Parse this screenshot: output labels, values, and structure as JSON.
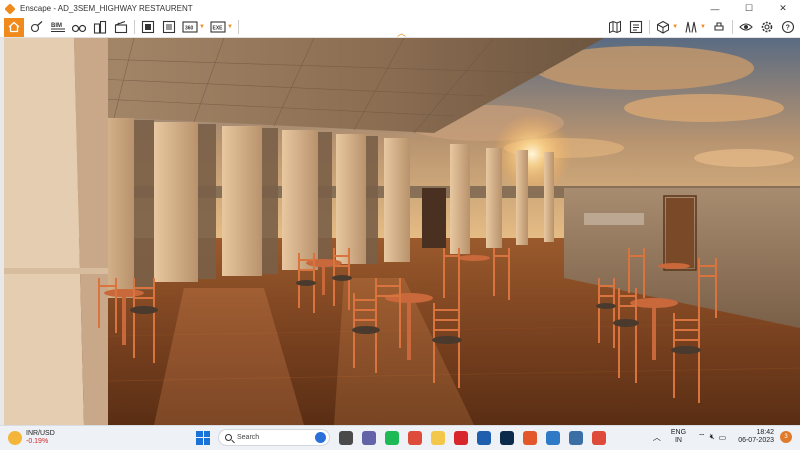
{
  "window": {
    "title": "Enscape - AD_3SEM_HIGHWAY RESTAURENT",
    "controls": [
      "—",
      "☐",
      "✕"
    ]
  },
  "toolbar": {
    "left_icons": [
      "home-icon",
      "walk-mode-icon",
      "bim-icon",
      "binoculars-icon",
      "buildings-icon",
      "clapper-icon",
      "screenshot-icon",
      "batch-render-icon",
      "panorama-icon",
      "export-icon"
    ],
    "right_icons": [
      "map-icon",
      "views-icon",
      "asset-library-icon",
      "material-editor-icon",
      "upload-icon",
      "visual-settings-icon",
      "settings-icon",
      "help-icon"
    ],
    "bim_label": "BIM",
    "view360_label": "360",
    "exe_label": "EXE"
  },
  "colors": {
    "accent": "#f08a1c"
  },
  "taskbar": {
    "weather_title": "INR/USD",
    "weather_sub": "-0.19%",
    "search_label": "Search",
    "lang_top": "ENG",
    "lang_bottom": "IN",
    "time": "18:42",
    "date": "06-07-2023",
    "notif_count": "3",
    "apps": [
      {
        "name": "task-view-icon",
        "color": "#4a4a4a"
      },
      {
        "name": "teams-icon",
        "color": "#6264a7"
      },
      {
        "name": "spotify-icon",
        "color": "#1db954"
      },
      {
        "name": "chrome-icon",
        "color": "#de4b3b"
      },
      {
        "name": "file-explorer-icon",
        "color": "#f3c84a"
      },
      {
        "name": "acrobat-icon",
        "color": "#d8262d"
      },
      {
        "name": "revit-icon",
        "color": "#1f5fae"
      },
      {
        "name": "photoshop-icon",
        "color": "#0c2b4a"
      },
      {
        "name": "brave-icon",
        "color": "#e2572c"
      },
      {
        "name": "sketchup-icon",
        "color": "#2e7ac7"
      },
      {
        "name": "photos-icon",
        "color": "#3a6ea5"
      },
      {
        "name": "chrome-profile-icon",
        "color": "#de4b3b"
      }
    ]
  }
}
